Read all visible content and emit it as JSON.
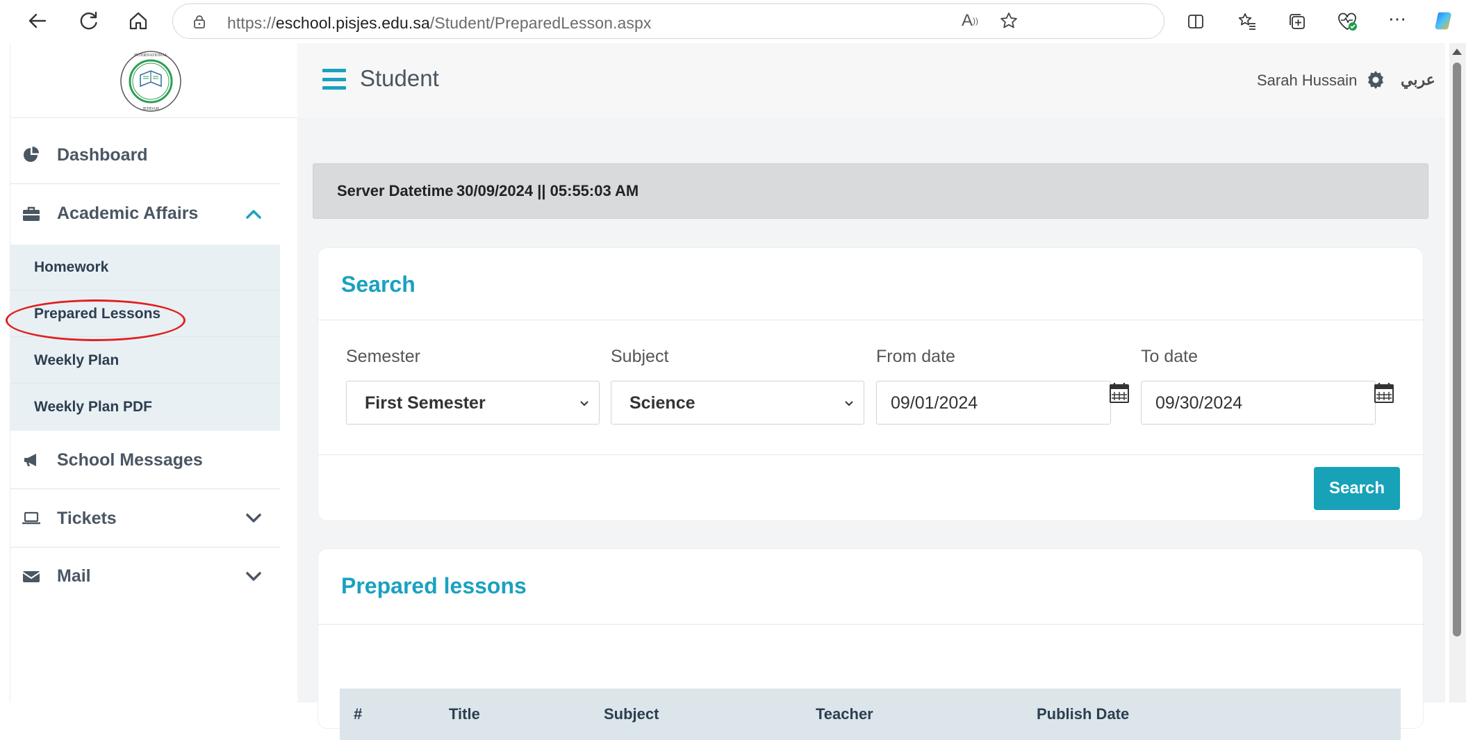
{
  "browser": {
    "url_prefix": "https://",
    "url_host": "eschool.pisjes.edu.sa",
    "url_path": "/Student/PreparedLesson.aspx",
    "read_aloud_label": "Aᵀ"
  },
  "sidebar": {
    "logo_text": "PAKISTAN INTERNATIONAL SCHOOL JEDDAH",
    "items": [
      {
        "label": "Dashboard",
        "icon": "pie-chart-icon"
      },
      {
        "label": "Academic Affairs",
        "icon": "briefcase-icon",
        "expanded": true
      },
      {
        "label": "School Messages",
        "icon": "megaphone-icon"
      },
      {
        "label": "Tickets",
        "icon": "laptop-icon",
        "expanded": false
      },
      {
        "label": "Mail",
        "icon": "envelope-icon",
        "expanded": false
      }
    ],
    "submenu": [
      {
        "label": "Homework"
      },
      {
        "label": "Prepared Lessons"
      },
      {
        "label": "Weekly Plan"
      },
      {
        "label": "Weekly Plan PDF"
      }
    ]
  },
  "header": {
    "title": "Student",
    "user_name": "Sarah Hussain",
    "language": "عربي"
  },
  "server": {
    "label": "Server Datetime",
    "value": "30/09/2024 || 05:55:03 AM"
  },
  "search_card": {
    "title": "Search",
    "semester_label": "Semester",
    "semester_value": "First Semester",
    "subject_label": "Subject",
    "subject_value": "Science",
    "from_label": "From date",
    "from_value": "09/01/2024",
    "to_label": "To date",
    "to_value": "09/30/2024",
    "button_label": "Search"
  },
  "lessons_card": {
    "title": "Prepared lessons",
    "columns": [
      "#",
      "Title",
      "Subject",
      "Teacher",
      "Publish Date"
    ]
  },
  "colors": {
    "accent": "#1aa1c0",
    "button": "#17a2b8",
    "annotation": "#e02020"
  }
}
